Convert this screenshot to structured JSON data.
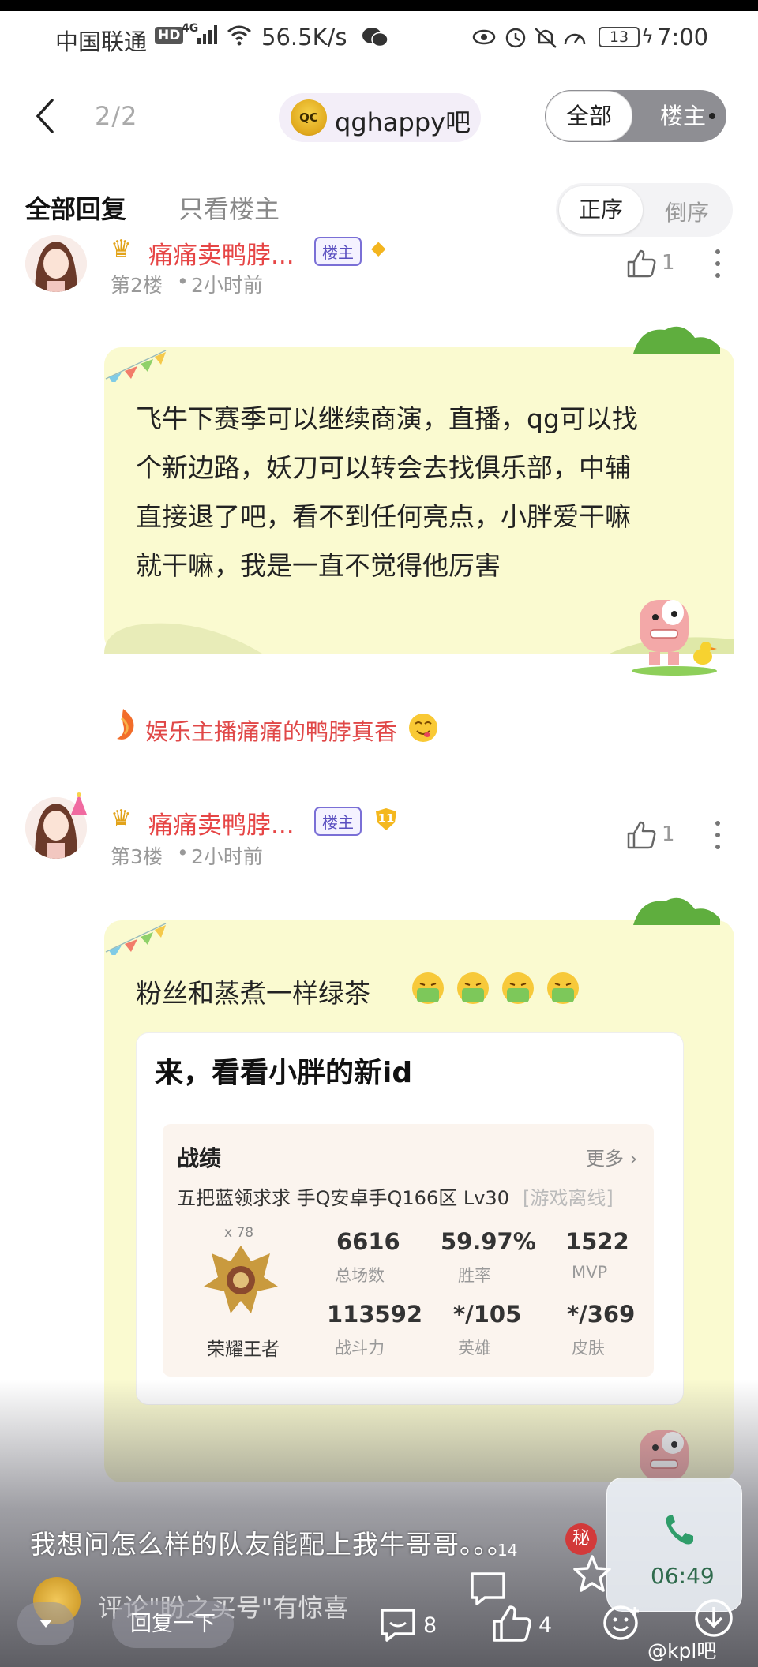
{
  "status_bar": {
    "carrier": "中国联通",
    "hd": "HD",
    "network": "4G",
    "speed": "56.5K/s",
    "battery": "13",
    "time": "7:00"
  },
  "nav": {
    "page_indicator": "2/2",
    "forum_logo_text": "QC",
    "forum_name": "qghappy吧",
    "segment_all": "全部",
    "segment_owner": "楼主"
  },
  "filter": {
    "all_replies": "全部回复",
    "owner_only": "只看楼主",
    "order_asc": "正序",
    "order_desc": "倒序"
  },
  "posts": [
    {
      "name": "痛痛卖鸭脖...",
      "tag": "楼主",
      "floor": "第2楼",
      "time": "2小时前",
      "likes": "1",
      "content_lines": [
        "飞牛下赛季可以继续商演，直播，qg可以找",
        "个新边路，妖刀可以转会去找俱乐部，中辅",
        "直接退了吧，看不到任何亮点，小胖爱干嘛",
        "就干嘛，我是一直不觉得他厉害"
      ],
      "signature": "娱乐主播痛痛的鸭脖真香"
    },
    {
      "name": "痛痛卖鸭脖...",
      "tag": "楼主",
      "level": "11",
      "floor": "第3楼",
      "time": "2小时前",
      "likes": "1",
      "content": "粉丝和蒸煮一样绿茶",
      "embed": {
        "title": "来，看看小胖的新id",
        "section": "战绩",
        "more": "更多 ›",
        "profile_line": "五把蓝领求求   手Q安卓手Q166区   Lv30",
        "offline": "[游戏离线]",
        "star_count": "x 78",
        "rank": "荣耀王者",
        "stats": [
          {
            "value": "6616",
            "label": "总场数"
          },
          {
            "value": "59.97%",
            "label": "胜率"
          },
          {
            "value": "1522",
            "label": "MVP"
          },
          {
            "value": "113592",
            "label": "战斗力"
          },
          {
            "value": "*/105",
            "label": "英雄"
          },
          {
            "value": "*/369",
            "label": "皮肤"
          }
        ]
      }
    }
  ],
  "overlay": {
    "caption": "我想问怎么样的队友能配上我牛哥哥。。。",
    "secret_badge": "秘",
    "call_time": "06:49",
    "comment_hint": "评论\"盼之买号\"有惊喜",
    "reply_label": "回复一下",
    "comment_count": "8",
    "like_count": "4",
    "like_badge": "14",
    "watermark": "@kpl吧"
  },
  "colors": {
    "name_red": "#e64545",
    "card_yellow": "#fafad0",
    "owner_tag": "#5a4fc0"
  }
}
